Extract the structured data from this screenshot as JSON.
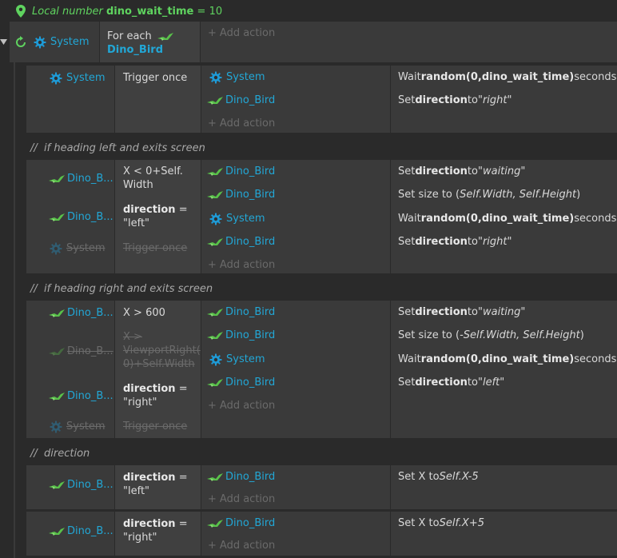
{
  "localvar": {
    "prefix": "Local number",
    "name": "dino_wait_time",
    "eq": "=",
    "value": "10"
  },
  "add_action": "Add action",
  "topblock": {
    "obj": "System",
    "cond1": "For each",
    "cond2": "Dino_Bird"
  },
  "block1": {
    "cond_obj": "System",
    "cond_txt": "Trigger once",
    "actions": [
      {
        "obj": "System",
        "pre": "Wait ",
        "bold": "random(0,dino_wait_time)",
        "post": " seconds",
        "ital": ""
      },
      {
        "obj": "Dino_Bird",
        "pre": "Set ",
        "bold": "direction",
        "post": " to ",
        "ital": "\"right\""
      }
    ]
  },
  "comment1": "if heading left and exits screen",
  "block2": {
    "c1_obj": "Dino_B...",
    "c1_l1": "X < 0+Self.",
    "c1_l2": "Width",
    "c2_obj": "Dino_B...",
    "c2_b": "direction",
    "c2_eq": " =",
    "c2_l2": "\"left\"",
    "c3_obj": "System",
    "c3_txt": "Trigger once",
    "actions": [
      {
        "obj": "Dino_Bird",
        "pre": "Set ",
        "bold": "direction",
        "post": " to ",
        "ital": "\"waiting\""
      },
      {
        "obj": "Dino_Bird",
        "pre": "Set size to (",
        "ital": "Self.Width, Self.Height",
        "post": ")"
      },
      {
        "obj": "System",
        "pre": "Wait ",
        "bold": "random(0,dino_wait_time)",
        "post": " seconds"
      },
      {
        "obj": "Dino_Bird",
        "pre": "Set ",
        "bold": "direction",
        "post": " to ",
        "ital": "\"right\""
      }
    ]
  },
  "comment2": "if heading right and exits screen",
  "block3": {
    "c1_obj": "Dino_B...",
    "c1_txt": "X > 600",
    "c2_obj": "Dino_B...",
    "c2_l1": "X >",
    "c2_l2": "ViewportRight(",
    "c2_l3": "0)+Self.Width",
    "c3_obj": "Dino_B...",
    "c3_b": "direction",
    "c3_eq": " =",
    "c3_l2": "\"right\"",
    "c4_obj": "System",
    "c4_txt": "Trigger once",
    "actions": [
      {
        "obj": "Dino_Bird",
        "pre": "Set ",
        "bold": "direction",
        "post": " to ",
        "ital": "\"waiting\""
      },
      {
        "obj": "Dino_Bird",
        "pre": "Set size to (",
        "ital": "-Self.Width, Self.Height",
        "post": ")"
      },
      {
        "obj": "System",
        "pre": "Wait ",
        "bold": "random(0,dino_wait_time)",
        "post": " seconds"
      },
      {
        "obj": "Dino_Bird",
        "pre": "Set ",
        "bold": "direction",
        "post": " to ",
        "ital": "\"left\""
      }
    ]
  },
  "comment3": "direction",
  "block4": {
    "c_obj": "Dino_B...",
    "c_b": "direction",
    "c_eq": " =",
    "c_l2": "\"left\"",
    "a_obj": "Dino_Bird",
    "a_pre": "Set X to ",
    "a_ital": "Self.X-5"
  },
  "block5": {
    "c_obj": "Dino_B...",
    "c_b": "direction",
    "c_eq": " =",
    "c_l2": "\"right\"",
    "a_obj": "Dino_Bird",
    "a_pre": "Set X to ",
    "a_ital": "Self.X+5"
  },
  "colors": {
    "obj": "#22a7d6",
    "localvar": "#5fd35f",
    "bg": "#2a2a2a"
  }
}
